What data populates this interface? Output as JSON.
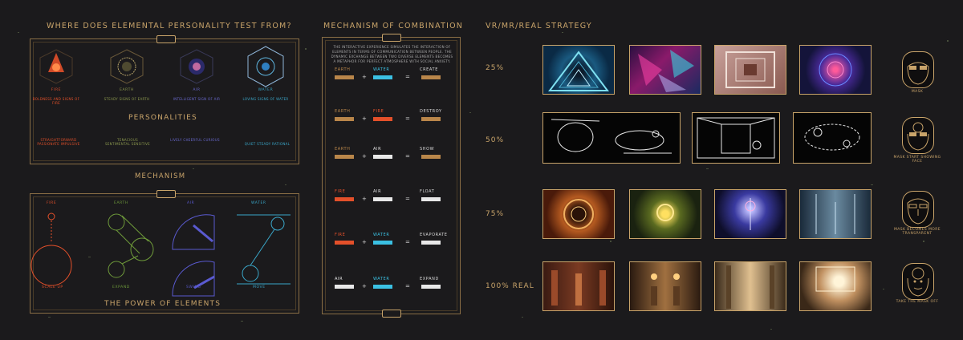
{
  "left_panel": {
    "title": "WHERE DOES ELEMENTAL PERSONALITY TEST FROM?",
    "elements": [
      {
        "name": "FIRE",
        "color": "#e4502a",
        "caption": "BOLDNESS AND SIGNS OF FIRE"
      },
      {
        "name": "EARTH",
        "color": "#8d9a4e",
        "caption": "STEADY SIGNS OF EARTH"
      },
      {
        "name": "AIR",
        "color": "#6a6ad0",
        "caption": "INTELLIGENT SIGN OF AIR"
      },
      {
        "name": "WATER",
        "color": "#3aa7c9",
        "caption": "LOVING SIGNS OF WATER"
      }
    ],
    "personalities_title": "PERSONALITIES",
    "personalities": [
      "STRAIGHTFORWARD PASSIONATE IMPULSIVE",
      "TENACIOUS SENTIMENTAL SENSITIVE",
      "LIVELY CHEERFUL CURIOUS",
      "QUIET STEADY RATIONAL"
    ],
    "mechanism_title": "MECHANISM",
    "mechanism": [
      {
        "name": "FIRE",
        "action": "SCALE UP"
      },
      {
        "name": "EARTH",
        "action": "EXPAND"
      },
      {
        "name": "AIR",
        "action": "SWING"
      },
      {
        "name": "WATER",
        "action": "MOVE"
      }
    ],
    "footer_title": "THE POWER OF ELEMENTS"
  },
  "middle_panel": {
    "title": "MECHANISM OF COMBINATION",
    "intro": "THE INTERACTIVE EXPERIENCE SIMULATES THE INTERACTION OF ELEMENTS IN TERMS OF COMMUNICATION BETWEEN PEOPLE. THE DYNAMIC EXCHANGE BETWEEN TWO DIVERSE ELEMENTS BECOMES A METAPHOR FOR PERFECT ATMOSPHERE WITH SOCIAL ANXIETY.",
    "rows": [
      {
        "a": "EARTH",
        "b": "WATER",
        "result": "CREATE",
        "a_color": "#b9864a",
        "b_color": "#3bc0e2",
        "r_color": "#b9864a"
      },
      {
        "a": "EARTH",
        "b": "FIRE",
        "result": "DESTROY",
        "a_color": "#b9864a",
        "b_color": "#e4502a",
        "r_color": "#b9864a"
      },
      {
        "a": "EARTH",
        "b": "AIR",
        "result": "SHOW",
        "a_color": "#b9864a",
        "b_color": "#e8e8e8",
        "r_color": "#b9864a"
      },
      {
        "a": "FIRE",
        "b": "AIR",
        "result": "FLOAT",
        "a_color": "#e4502a",
        "b_color": "#e8e8e8",
        "r_color": "#e8e8e8"
      },
      {
        "a": "FIRE",
        "b": "WATER",
        "result": "EVAPORATE",
        "a_color": "#e4502a",
        "b_color": "#3bc0e2",
        "r_color": "#e8e8e8"
      },
      {
        "a": "AIR",
        "b": "WATER",
        "result": "EXPAND",
        "a_color": "#e8e8e8",
        "b_color": "#3bc0e2",
        "r_color": "#e8e8e8"
      }
    ],
    "plus": "+",
    "equals": "="
  },
  "right_panel": {
    "title": "VR/MR/REAL STRATEGY",
    "rows": [
      {
        "level": "25%",
        "mask_caption": "MASK"
      },
      {
        "level": "50%",
        "mask_caption": "MASK START SHOWING FACE"
      },
      {
        "level": "75%",
        "mask_caption": "MASK BECOMES MORE TRANSPARENT"
      },
      {
        "level": "100% REAL",
        "mask_caption": "TAKE THE MASK OFF"
      }
    ]
  }
}
